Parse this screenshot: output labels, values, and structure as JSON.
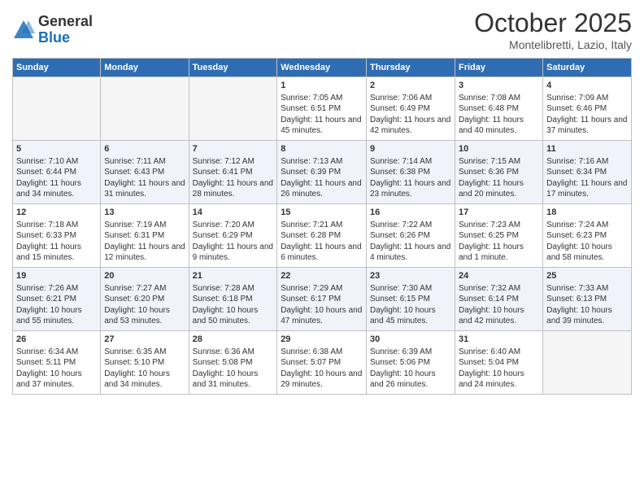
{
  "header": {
    "logo_general": "General",
    "logo_blue": "Blue",
    "month": "October 2025",
    "location": "Montelibretti, Lazio, Italy"
  },
  "days_of_week": [
    "Sunday",
    "Monday",
    "Tuesday",
    "Wednesday",
    "Thursday",
    "Friday",
    "Saturday"
  ],
  "weeks": [
    [
      {
        "day": "",
        "info": ""
      },
      {
        "day": "",
        "info": ""
      },
      {
        "day": "",
        "info": ""
      },
      {
        "day": "1",
        "info": "Sunrise: 7:05 AM\nSunset: 6:51 PM\nDaylight: 11 hours and 45 minutes."
      },
      {
        "day": "2",
        "info": "Sunrise: 7:06 AM\nSunset: 6:49 PM\nDaylight: 11 hours and 42 minutes."
      },
      {
        "day": "3",
        "info": "Sunrise: 7:08 AM\nSunset: 6:48 PM\nDaylight: 11 hours and 40 minutes."
      },
      {
        "day": "4",
        "info": "Sunrise: 7:09 AM\nSunset: 6:46 PM\nDaylight: 11 hours and 37 minutes."
      }
    ],
    [
      {
        "day": "5",
        "info": "Sunrise: 7:10 AM\nSunset: 6:44 PM\nDaylight: 11 hours and 34 minutes."
      },
      {
        "day": "6",
        "info": "Sunrise: 7:11 AM\nSunset: 6:43 PM\nDaylight: 11 hours and 31 minutes."
      },
      {
        "day": "7",
        "info": "Sunrise: 7:12 AM\nSunset: 6:41 PM\nDaylight: 11 hours and 28 minutes."
      },
      {
        "day": "8",
        "info": "Sunrise: 7:13 AM\nSunset: 6:39 PM\nDaylight: 11 hours and 26 minutes."
      },
      {
        "day": "9",
        "info": "Sunrise: 7:14 AM\nSunset: 6:38 PM\nDaylight: 11 hours and 23 minutes."
      },
      {
        "day": "10",
        "info": "Sunrise: 7:15 AM\nSunset: 6:36 PM\nDaylight: 11 hours and 20 minutes."
      },
      {
        "day": "11",
        "info": "Sunrise: 7:16 AM\nSunset: 6:34 PM\nDaylight: 11 hours and 17 minutes."
      }
    ],
    [
      {
        "day": "12",
        "info": "Sunrise: 7:18 AM\nSunset: 6:33 PM\nDaylight: 11 hours and 15 minutes."
      },
      {
        "day": "13",
        "info": "Sunrise: 7:19 AM\nSunset: 6:31 PM\nDaylight: 11 hours and 12 minutes."
      },
      {
        "day": "14",
        "info": "Sunrise: 7:20 AM\nSunset: 6:29 PM\nDaylight: 11 hours and 9 minutes."
      },
      {
        "day": "15",
        "info": "Sunrise: 7:21 AM\nSunset: 6:28 PM\nDaylight: 11 hours and 6 minutes."
      },
      {
        "day": "16",
        "info": "Sunrise: 7:22 AM\nSunset: 6:26 PM\nDaylight: 11 hours and 4 minutes."
      },
      {
        "day": "17",
        "info": "Sunrise: 7:23 AM\nSunset: 6:25 PM\nDaylight: 11 hours and 1 minute."
      },
      {
        "day": "18",
        "info": "Sunrise: 7:24 AM\nSunset: 6:23 PM\nDaylight: 10 hours and 58 minutes."
      }
    ],
    [
      {
        "day": "19",
        "info": "Sunrise: 7:26 AM\nSunset: 6:21 PM\nDaylight: 10 hours and 55 minutes."
      },
      {
        "day": "20",
        "info": "Sunrise: 7:27 AM\nSunset: 6:20 PM\nDaylight: 10 hours and 53 minutes."
      },
      {
        "day": "21",
        "info": "Sunrise: 7:28 AM\nSunset: 6:18 PM\nDaylight: 10 hours and 50 minutes."
      },
      {
        "day": "22",
        "info": "Sunrise: 7:29 AM\nSunset: 6:17 PM\nDaylight: 10 hours and 47 minutes."
      },
      {
        "day": "23",
        "info": "Sunrise: 7:30 AM\nSunset: 6:15 PM\nDaylight: 10 hours and 45 minutes."
      },
      {
        "day": "24",
        "info": "Sunrise: 7:32 AM\nSunset: 6:14 PM\nDaylight: 10 hours and 42 minutes."
      },
      {
        "day": "25",
        "info": "Sunrise: 7:33 AM\nSunset: 6:13 PM\nDaylight: 10 hours and 39 minutes."
      }
    ],
    [
      {
        "day": "26",
        "info": "Sunrise: 6:34 AM\nSunset: 5:11 PM\nDaylight: 10 hours and 37 minutes."
      },
      {
        "day": "27",
        "info": "Sunrise: 6:35 AM\nSunset: 5:10 PM\nDaylight: 10 hours and 34 minutes."
      },
      {
        "day": "28",
        "info": "Sunrise: 6:36 AM\nSunset: 5:08 PM\nDaylight: 10 hours and 31 minutes."
      },
      {
        "day": "29",
        "info": "Sunrise: 6:38 AM\nSunset: 5:07 PM\nDaylight: 10 hours and 29 minutes."
      },
      {
        "day": "30",
        "info": "Sunrise: 6:39 AM\nSunset: 5:06 PM\nDaylight: 10 hours and 26 minutes."
      },
      {
        "day": "31",
        "info": "Sunrise: 6:40 AM\nSunset: 5:04 PM\nDaylight: 10 hours and 24 minutes."
      },
      {
        "day": "",
        "info": ""
      }
    ]
  ]
}
